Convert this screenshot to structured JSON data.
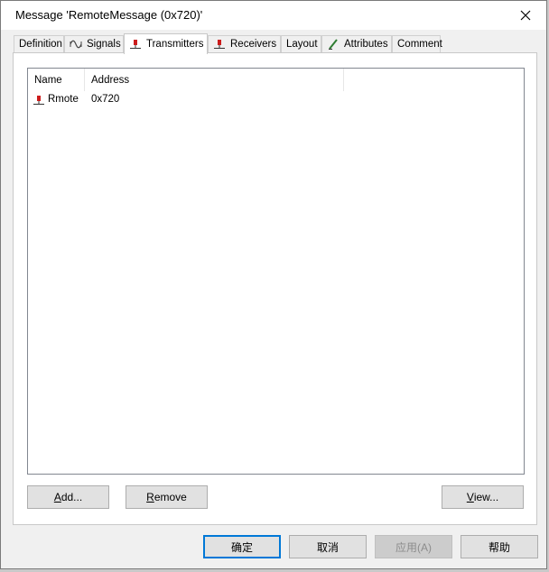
{
  "window": {
    "title": "Message 'RemoteMessage (0x720)'"
  },
  "tabs": [
    {
      "label": "Definition",
      "icon": "none"
    },
    {
      "label": "Signals",
      "icon": "signal-wave-icon"
    },
    {
      "label": "Transmitters",
      "icon": "transmitter-node-icon",
      "active": true
    },
    {
      "label": "Receivers",
      "icon": "receiver-node-icon"
    },
    {
      "label": "Layout",
      "icon": "none"
    },
    {
      "label": "Attributes",
      "icon": "attribute-pencil-icon"
    },
    {
      "label": "Comment",
      "icon": "none"
    }
  ],
  "list": {
    "columns": [
      "Name",
      "Address"
    ],
    "rows": [
      {
        "name": "Rmote",
        "address": "0x720",
        "icon": "node-icon"
      }
    ]
  },
  "panel_buttons": {
    "add": {
      "mnemonic": "A",
      "rest": "dd..."
    },
    "remove": {
      "mnemonic": "R",
      "rest": "emove"
    },
    "view": {
      "mnemonic": "V",
      "rest": "iew..."
    }
  },
  "footer": {
    "ok": "确定",
    "cancel": "取消",
    "apply": "应用(A)",
    "help": "帮助"
  },
  "colors": {
    "node_icon_red": "#cc1c1c",
    "default_button_border": "#0078d7"
  }
}
